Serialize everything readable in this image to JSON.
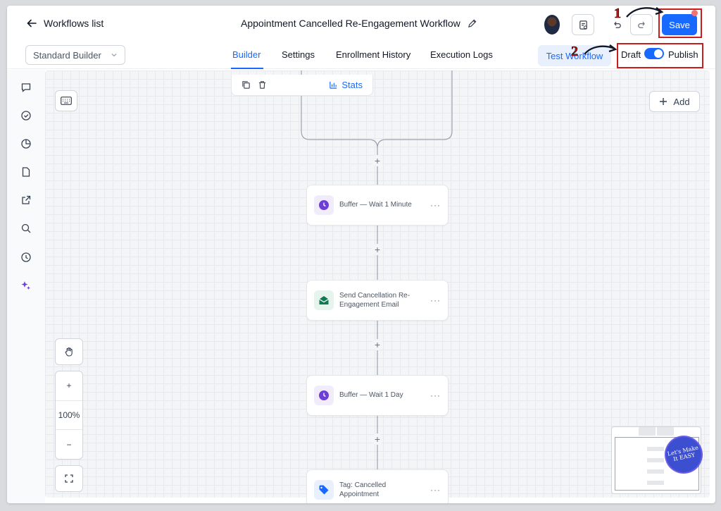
{
  "header": {
    "back_label": "Workflows list",
    "workflow_title": "Appointment Cancelled Re-Engagement Workflow",
    "save_label": "Save"
  },
  "subheader": {
    "builder_select_value": "Standard Builder",
    "tabs": [
      {
        "label": "Builder",
        "active": true
      },
      {
        "label": "Settings",
        "active": false
      },
      {
        "label": "Enrollment History",
        "active": false
      },
      {
        "label": "Execution Logs",
        "active": false
      }
    ],
    "test_workflow_label": "Test Workflow",
    "draft_label": "Draft",
    "publish_label": "Publish",
    "publish_toggle_on": true
  },
  "annotations": {
    "num1": "1",
    "num2": "2"
  },
  "sidebar": {
    "icons": [
      "chat-icon",
      "check-circle-icon",
      "pie-chart-icon",
      "document-icon",
      "external-link-icon",
      "search-icon",
      "clock-history-icon",
      "sparkle-icon"
    ]
  },
  "canvas": {
    "add_label": "Add",
    "stats_label": "Stats",
    "zoom_level": "100%",
    "zoom_in": "+",
    "zoom_out": "−",
    "nodes": [
      {
        "label": "Buffer — Wait 1 Minute",
        "icon": "clock-icon"
      },
      {
        "label": "Send Cancellation Re-Engagement Email",
        "icon": "email-icon"
      },
      {
        "label": "Buffer — Wait 1 Day",
        "icon": "clock-icon"
      },
      {
        "label": "Tag: Cancelled Appointment",
        "icon": "tag-icon"
      }
    ],
    "node_menu": "···",
    "plus": "+",
    "watermark_text": "Let's Make It EASY"
  },
  "colors": {
    "accent": "#1769ff",
    "annotation_red": "#c81e1e",
    "purple_icon": "#6d3fd8",
    "green_icon": "#0f7a55"
  }
}
